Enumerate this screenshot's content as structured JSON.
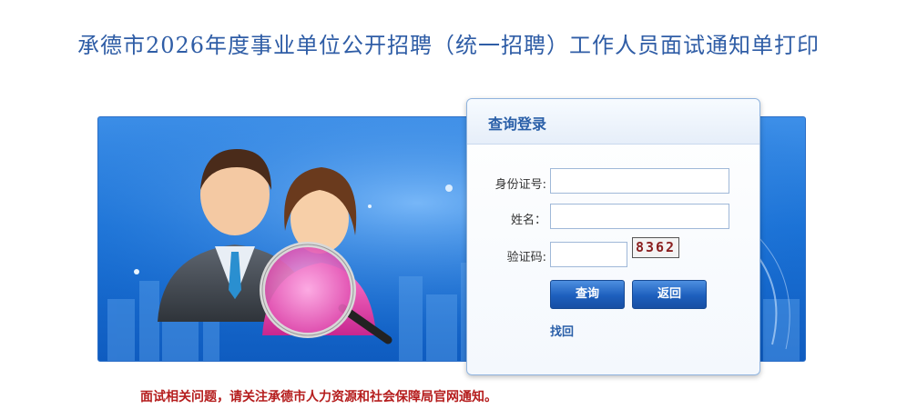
{
  "page": {
    "title": "承德市2026年度事业单位公开招聘（统一招聘）工作人员面试通知单打印"
  },
  "login": {
    "title": "查询登录",
    "id_label": "身份证号:",
    "id_value": "",
    "name_label": "姓名：",
    "name_value": "",
    "captcha_label": "验证码:",
    "captcha_value": "",
    "captcha_image_text": "8362",
    "query_button": "查询",
    "back_button": "返回",
    "retrieve_link": "找回"
  },
  "notice": {
    "text": "面试相关问题，请关注承德市人力资源和社会保障局官网通知。"
  },
  "colors": {
    "title_blue": "#2f5da6",
    "banner_blue": "#1b72d6",
    "notice_red": "#b51d1d"
  }
}
